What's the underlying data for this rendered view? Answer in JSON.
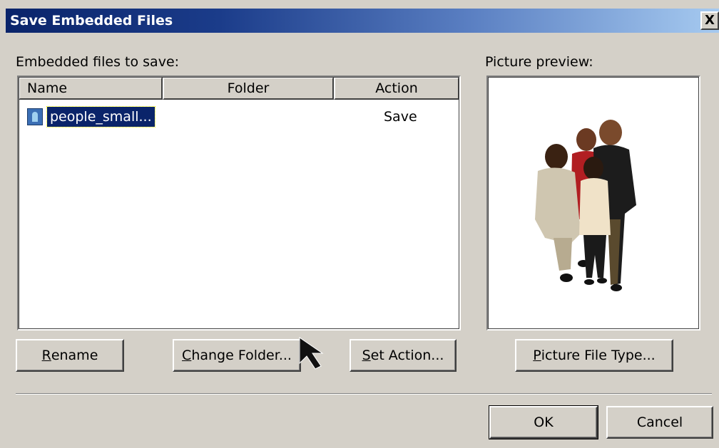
{
  "window": {
    "title": "Save Embedded Files",
    "close_glyph": "X"
  },
  "left_panel": {
    "label": "Embedded files to save:",
    "columns": [
      {
        "label": "Name"
      },
      {
        "label": "Folder"
      },
      {
        "label": "Action"
      }
    ],
    "rows": [
      {
        "name": "people_small...",
        "folder": "",
        "action": "Save",
        "icon": "image-file-icon",
        "selected": true
      }
    ]
  },
  "right_panel": {
    "label": "Picture preview:",
    "preview_icon": "people-group-photo"
  },
  "buttons": {
    "rename": {
      "mnemonic": "R",
      "rest": "ename"
    },
    "change_folder": {
      "mnemonic": "C",
      "rest": "hange Folder..."
    },
    "set_action": {
      "mnemonic": "S",
      "rest": "et Action..."
    },
    "picture_file_type": {
      "mnemonic": "P",
      "rest": "icture File Type..."
    },
    "ok": "OK",
    "cancel": "Cancel"
  },
  "colors": {
    "dialog_bg": "#d4d0c8",
    "title_start": "#0a246a",
    "title_end": "#a6caf0",
    "selection": "#0a246a"
  }
}
